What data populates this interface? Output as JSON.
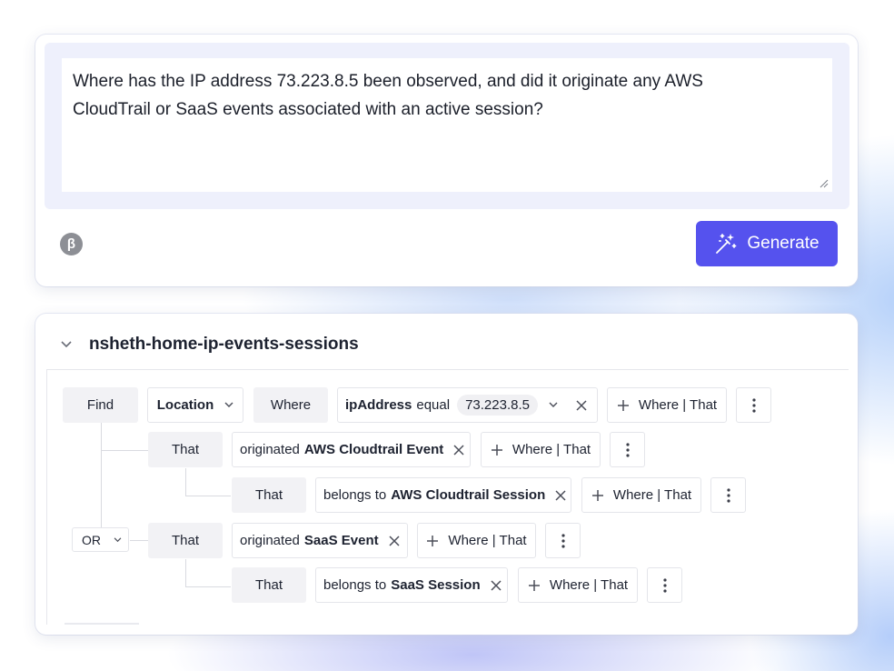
{
  "prompt": {
    "text_line1": "Where has the IP address 73.223.8.5 been observed, and did it originate any AWS",
    "text_line2": "CloudTrail or SaaS events associated with an active session?",
    "beta_label": "β",
    "generate_label": "Generate"
  },
  "query": {
    "title": "nsheth-home-ip-events-sessions",
    "find_label": "Find",
    "entity_label": "Location",
    "where_label": "Where",
    "condition": {
      "field": "ipAddress",
      "operator": "equal",
      "value": "73.223.8.5"
    },
    "add_label": "Where | That",
    "or_label": "OR",
    "rows": [
      {
        "that_label": "That",
        "prefix": "originated",
        "target": "AWS Cloudtrail Event"
      },
      {
        "that_label": "That",
        "prefix": "belongs to",
        "target": "AWS Cloudtrail Session"
      },
      {
        "that_label": "That",
        "prefix": "originated",
        "target": "SaaS Event"
      },
      {
        "that_label": "That",
        "prefix": "belongs to",
        "target": "SaaS Session"
      }
    ]
  },
  "colors": {
    "accent": "#5552ee",
    "prompt_bg": "#eef0fc",
    "chip_gray": "#f2f2f5"
  }
}
